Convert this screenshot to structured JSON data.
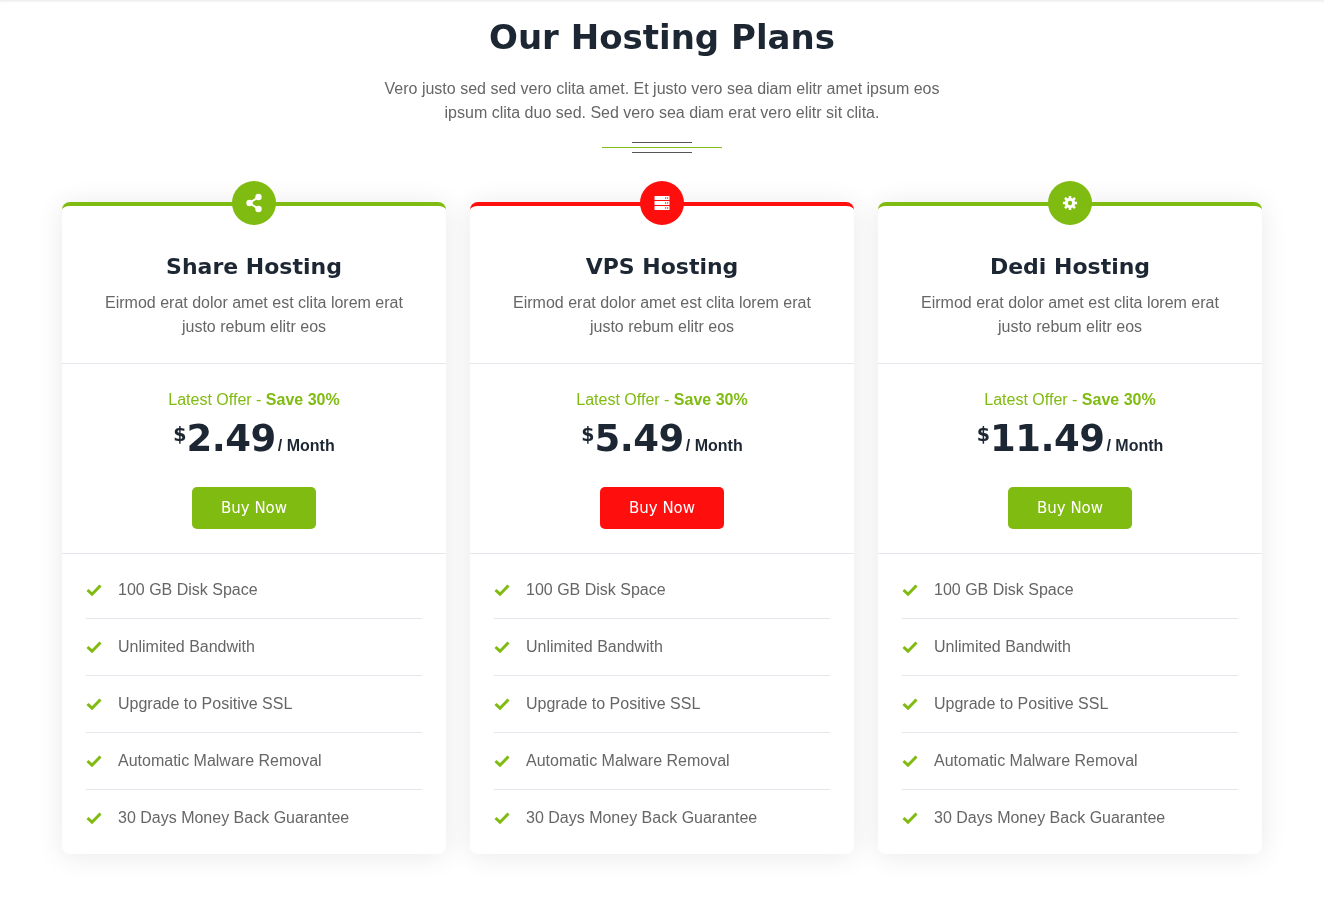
{
  "header": {
    "title": "Our Hosting Plans",
    "subtitle": "Vero justo sed sed vero clita amet. Et justo vero sea diam elitr amet ipsum eos ipsum clita duo sed. Sed vero sea diam erat vero elitr sit clita."
  },
  "plans": [
    {
      "kind": "shared",
      "color": "#80bb11",
      "title": "Share Hosting",
      "description": "Eirmod erat dolor amet est clita lorem erat justo rebum elitr eos",
      "offer": "Latest Offer - **Save 30%**",
      "currency": "$",
      "price": "2.49",
      "period": "/ Month",
      "button": "Buy Now",
      "features": [
        "100 GB Disk Space",
        "Unlimited Bandwith",
        "Upgrade to Positive SSL",
        "Automatic Malware Removal",
        "30 Days Money Back Guarantee"
      ]
    },
    {
      "kind": "vps",
      "color": "#ff0e0e",
      "title": "VPS Hosting",
      "description": "Eirmod erat dolor amet est clita lorem erat justo rebum elitr eos",
      "offer": "Latest Offer - **Save 30%**",
      "currency": "$",
      "price": "5.49",
      "period": "/ Month",
      "button": "Buy Now",
      "features": [
        "100 GB Disk Space",
        "Unlimited Bandwith",
        "Upgrade to Positive SSL",
        "Automatic Malware Removal",
        "30 Days Money Back Guarantee"
      ]
    },
    {
      "kind": "dedicated",
      "color": "#80bb11",
      "title": "Dedi Hosting",
      "description": "Eirmod erat dolor amet est clita lorem erat justo rebum elitr eos",
      "offer": "Latest Offer - **Save 30%**",
      "currency": "$",
      "price": "11.49",
      "period": "/ Month",
      "button": "Buy Now",
      "features": [
        "100 GB Disk Space",
        "Unlimited Bandwith",
        "Upgrade to Positive SSL",
        "Automatic Malware Removal",
        "30 Days Money Back Guarantee"
      ]
    }
  ]
}
